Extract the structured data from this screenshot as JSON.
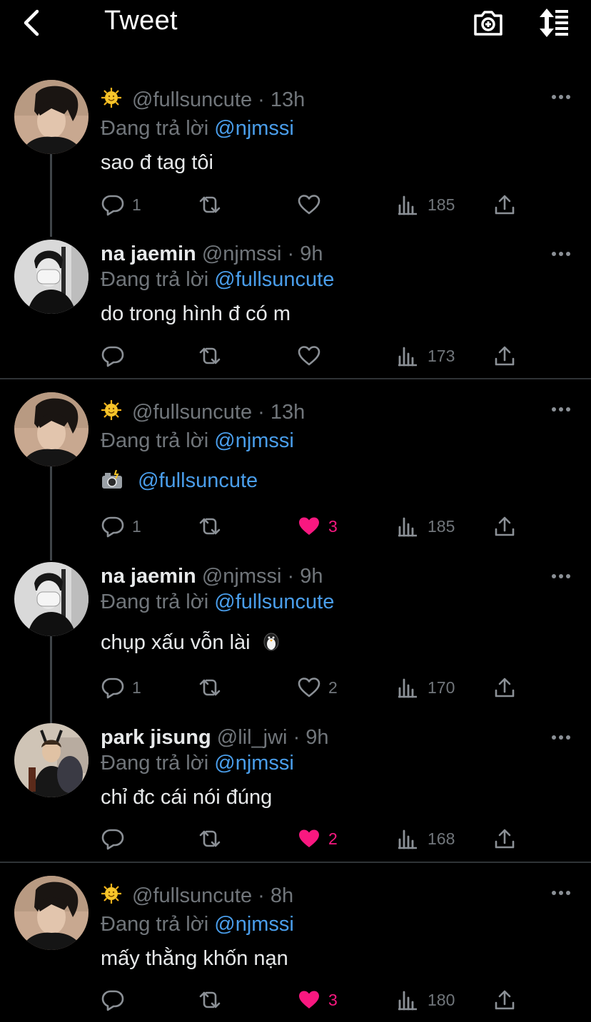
{
  "header": {
    "title": "Tweet",
    "back_icon": "chevron-left-icon",
    "camera_icon": "camera-plus-icon",
    "sort_icon": "sort-list-icon"
  },
  "reply_label": "Đang trả lời",
  "tweets": [
    {
      "name": "",
      "handle": "@fullsuncute",
      "time": "· 13h",
      "reply_to": "@njmssi",
      "text": "sao đ tag tôi",
      "replies": "1",
      "retweets": "",
      "likes": "",
      "views": "185",
      "liked": false
    },
    {
      "name": "na jaemin",
      "handle": "@njmssi",
      "time": "· 9h",
      "reply_to": "@fullsuncute",
      "text": "do trong hình đ có m",
      "replies": "",
      "retweets": "",
      "likes": "",
      "views": "173",
      "liked": false
    },
    {
      "name": "",
      "handle": "@fullsuncute",
      "time": "· 13h",
      "reply_to": "@njmssi",
      "text": "@fullsuncute",
      "replies": "1",
      "retweets": "",
      "likes": "3",
      "views": "185",
      "liked": true
    },
    {
      "name": "na jaemin",
      "handle": "@njmssi",
      "time": "· 9h",
      "reply_to": "@fullsuncute",
      "text": "chụp xấu vỗn lài",
      "replies": "1",
      "retweets": "",
      "likes": "2",
      "views": "170",
      "liked": false
    },
    {
      "name": "park jisung",
      "handle": "@lil_jwi",
      "time": "· 9h",
      "reply_to": "@njmssi",
      "text": "chỉ đc cái nói đúng",
      "replies": "",
      "retweets": "",
      "likes": "2",
      "views": "168",
      "liked": true
    },
    {
      "name": "",
      "handle": "@fullsuncute",
      "time": "· 8h",
      "reply_to": "@njmssi",
      "text": "mấy thằng khốn nạn",
      "replies": "",
      "retweets": "",
      "likes": "3",
      "views": "180",
      "liked": true
    }
  ],
  "colors": {
    "background": "#000000",
    "text": "#e7e9ea",
    "muted": "#71767b",
    "link": "#4a9eeb",
    "like": "#f91880",
    "divider": "#2f3336"
  }
}
